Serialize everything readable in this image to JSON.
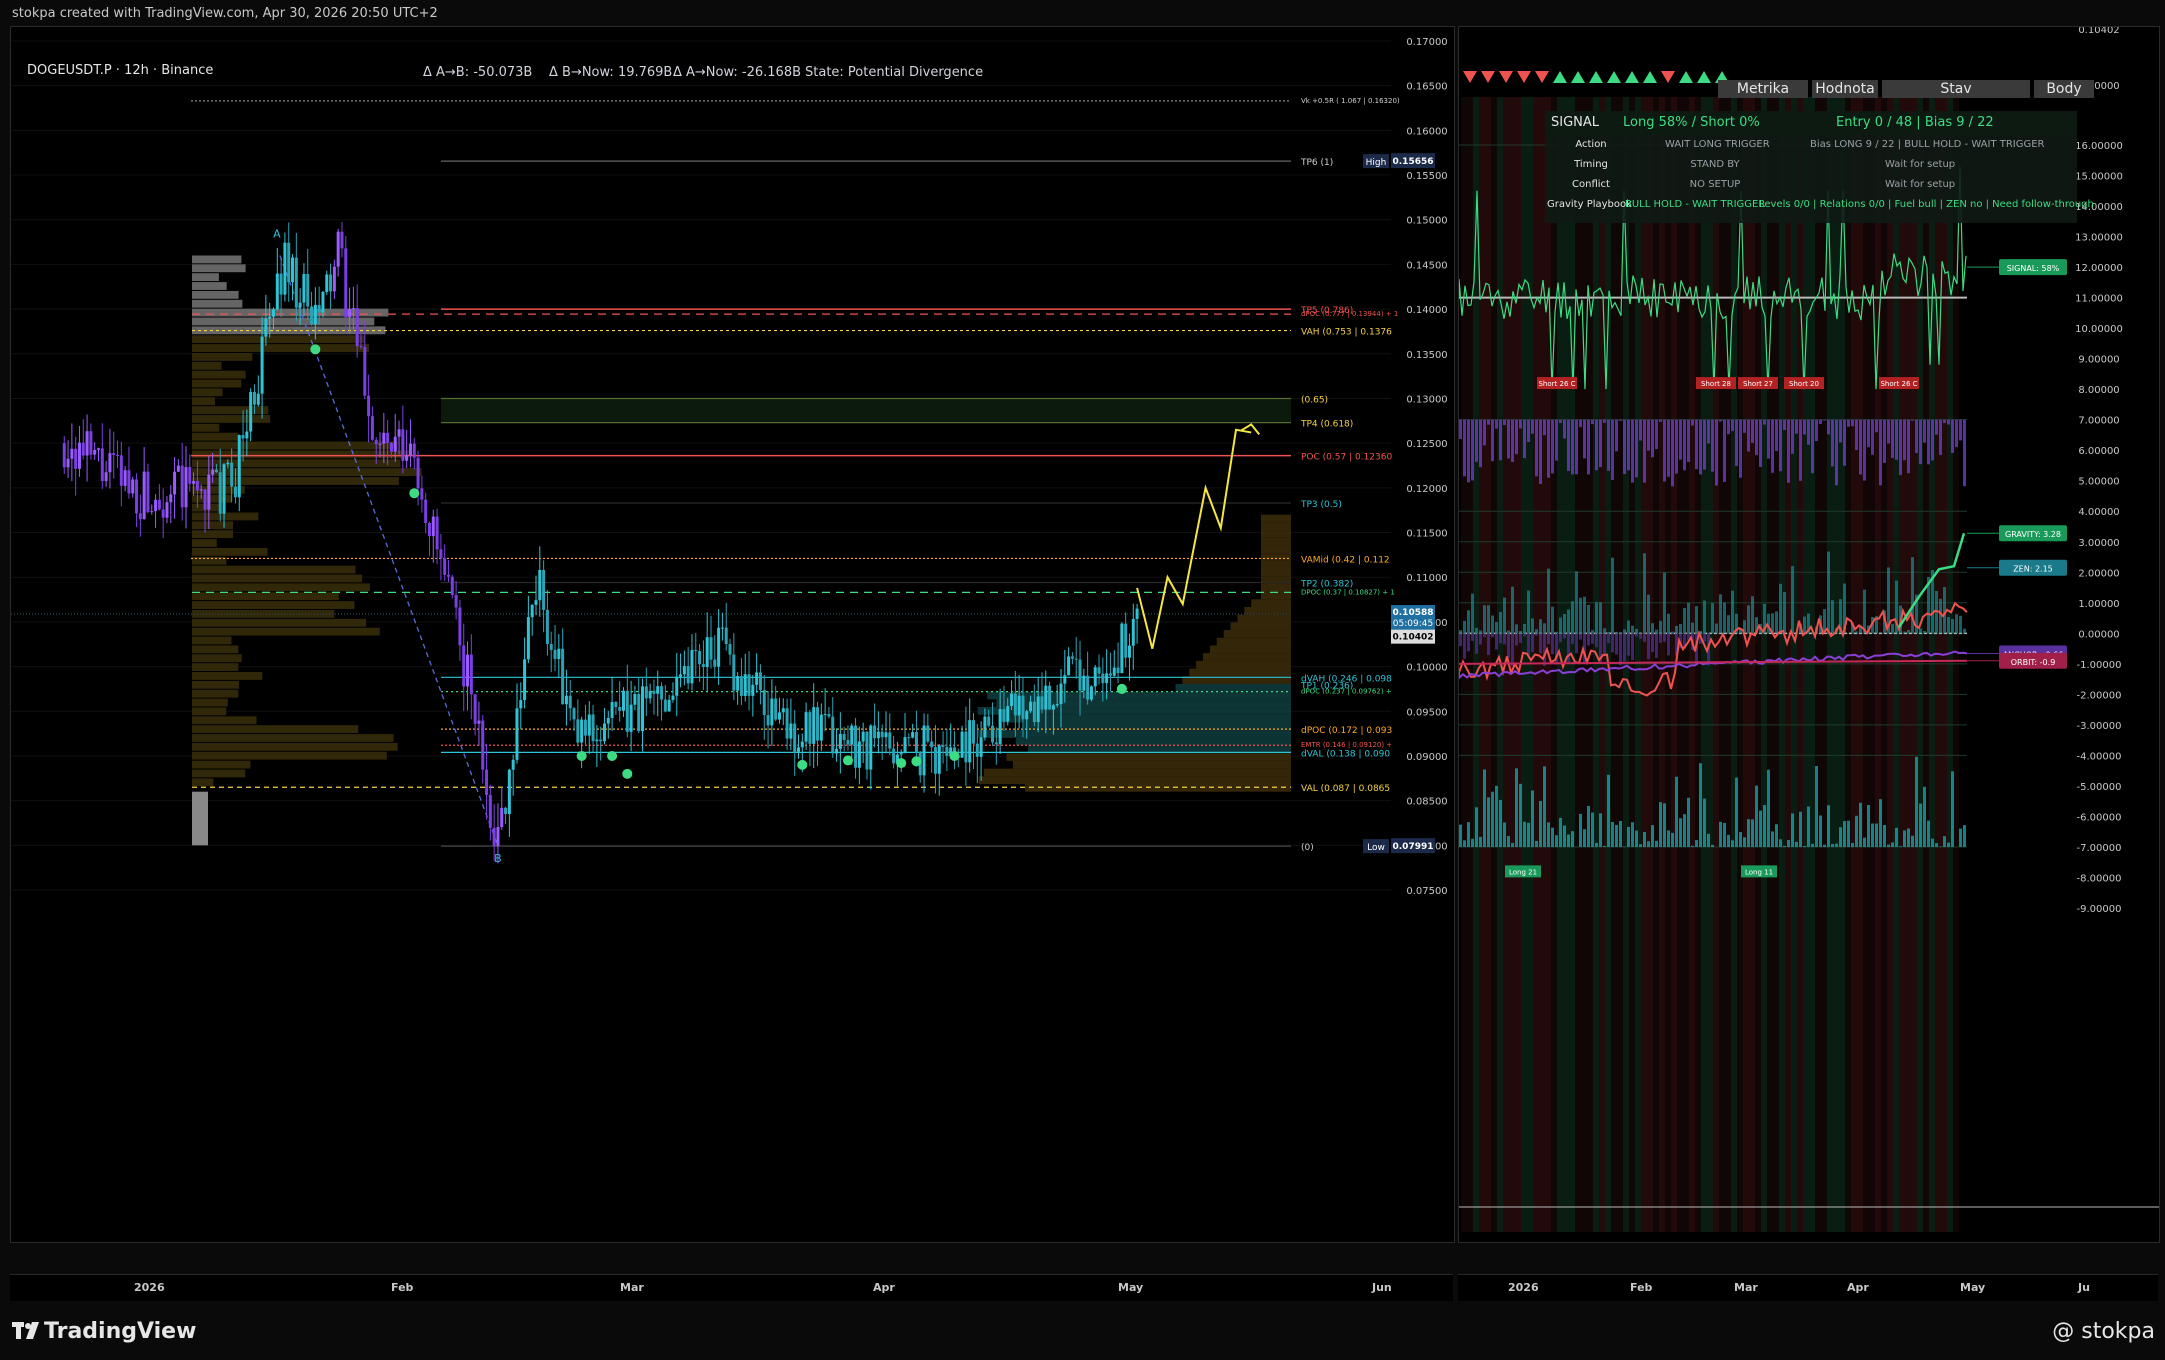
{
  "header": {
    "created_by": "stokpa created with TradingView.com, Apr 30, 2026 20:50 UTC+2"
  },
  "main": {
    "symbol": "DOGEUSDT.P · 12h · Binance",
    "legend": [
      {
        "text": "Δ A→B: -50.073B",
        "color": "#9a5cff"
      },
      {
        "text": "Δ B→Now: 19.769B",
        "color": "#2ec4d6"
      },
      {
        "text": "Δ A→Now: -26.168B",
        "color": "#9a5cff"
      },
      {
        "text": "State: Potential Divergence",
        "color": "#ffa726"
      }
    ],
    "price_axis": [
      "0.17000",
      "0.16500",
      "0.16000",
      "0.15500",
      "0.15000",
      "0.14500",
      "0.14000",
      "0.13500",
      "0.13000",
      "0.12500",
      "0.12000",
      "0.11500",
      "0.11000",
      "0.10500",
      "0.10000",
      "0.09500",
      "0.09000",
      "0.08500",
      "0.08000",
      "0.07500"
    ],
    "badges": {
      "high_label": "High",
      "high_value": "0.15656",
      "price_value": "0.10588",
      "countdown": "05:09:45",
      "low_price": "0.10402",
      "low_label": "Low",
      "low_value": "0.07991"
    },
    "markers": {
      "A": "A",
      "B": "B"
    },
    "levels": [
      {
        "text": "Vk +0.5R ( 1.067 | 0.16320)",
        "color": "#cfcfcf",
        "price": 0.1633,
        "small": true
      },
      {
        "text": "TP6 (1)",
        "color": "#cfcfcf",
        "price": 0.15656
      },
      {
        "text": "TP5 (0.786)",
        "color": "#ef5350",
        "price": 0.14
      },
      {
        "text": "dPOC (0.777 | 0.13944) + 1",
        "color": "#ef5350",
        "price": 0.13944,
        "small": true
      },
      {
        "text": "VAH (0.753 | 0.1376",
        "color": "#f5d142",
        "price": 0.1376
      },
      {
        "text": "(0.65)",
        "color": "#f5d142",
        "price": 0.13
      },
      {
        "text": "TP4 (0.618)",
        "color": "#f5d142",
        "price": 0.1273
      },
      {
        "text": "POC (0.57 | 0.12360",
        "color": "#ef5350",
        "price": 0.1236
      },
      {
        "text": "TP3 (0.5)",
        "color": "#2ec4d6",
        "price": 0.1183
      },
      {
        "text": "VAMid (0.42 | 0.112",
        "color": "#ffa726",
        "price": 0.1121
      },
      {
        "text": "TP2 (0.382)",
        "color": "#2ec4d6",
        "price": 0.1094
      },
      {
        "text": "DPOC (0.37 | 0.10827) + 1",
        "color": "#3ddc84",
        "price": 0.1083,
        "small": true
      },
      {
        "text": "dVAH (0.246 | 0.098",
        "color": "#2ec4d6",
        "price": 0.0988
      },
      {
        "text": "TP1 (0.236)",
        "color": "#2ec4d6",
        "price": 0.098
      },
      {
        "text": "dPOC (0.237 | 0.09762) +",
        "color": "#3ddc84",
        "price": 0.0972,
        "small": true
      },
      {
        "text": "dPOC (0.172 | 0.093",
        "color": "#ffa726",
        "price": 0.093
      },
      {
        "text": "EMTR (0.146 | 0.09120) +",
        "color": "#ef5350",
        "price": 0.0912,
        "small": true
      },
      {
        "text": "dVAL (0.138 | 0.090",
        "color": "#2ec4d6",
        "price": 0.0904
      },
      {
        "text": "VAL (0.087 | 0.0865",
        "color": "#f5d142",
        "price": 0.0865
      },
      {
        "text": "(0)",
        "color": "#cfcfcf",
        "price": 0.07991
      }
    ],
    "time_axis": [
      "2026",
      "Feb",
      "Mar",
      "Apr",
      "May",
      "Jun"
    ]
  },
  "sub": {
    "tabs": [
      "Metrika",
      "Hodnota",
      "Stav",
      "Body"
    ],
    "table": {
      "title": "SIGNAL",
      "long_short": "Long 58% / Short 0%",
      "entry": "Entry 0 / 48 | Bias 9 / 22",
      "rows": [
        {
          "metric": "Action",
          "value": "WAIT LONG TRIGGER",
          "state": "Bias LONG 9 / 22 | BULL HOLD - WAIT TRIGGER"
        },
        {
          "metric": "Timing",
          "value": "STAND BY",
          "state": "Wait for setup"
        },
        {
          "metric": "Conflict",
          "value": "NO SETUP",
          "state": "Wait for setup"
        },
        {
          "metric": "Gravity Playbook",
          "value": "BULL HOLD - WAIT TRIGGER",
          "state": "Levels 0/0 | Relations 0/0 | Fuel bull | ZEN no | Need follow-through"
        }
      ]
    },
    "axis": [
      "0.10402",
      "0.00000",
      "16.00000",
      "15.00000",
      "14.00000",
      "13.00000",
      "12.00000",
      "11.00000",
      "10.00000",
      "9.00000",
      "8.00000",
      "7.00000",
      "6.00000",
      "5.00000",
      "4.00000",
      "3.00000",
      "2.00000",
      "1.00000",
      "0.00000",
      "-1.00000",
      "-2.00000",
      "-3.00000",
      "-4.00000",
      "-5.00000",
      "-6.00000",
      "-7.00000",
      "-8.00000",
      "-9.00000"
    ],
    "tags": {
      "signal": "SIGNAL: 58%",
      "gravity": "GRAVITY: 3.28",
      "zen": "ZEN: 2.15",
      "anchor": "ANCHOR: -0.66",
      "orbit": "ORBIT: -0.9"
    },
    "short_labels": [
      "Short 26 C",
      "Short 28",
      "Short 27",
      "Short 20",
      "Short 26 C"
    ],
    "long_labels": [
      "Long 21",
      "Long 11"
    ],
    "time_axis": [
      "2026",
      "Feb",
      "Mar",
      "Apr",
      "May",
      "Ju"
    ]
  },
  "footer": {
    "logo": "TradingView",
    "author": "@ stokpa"
  },
  "chart_data": {
    "type": "line",
    "title": "DOGEUSDT.P · 12h · Binance",
    "xlabel": "",
    "ylabel": "",
    "x": [
      "2025-12-10",
      "2025-12-20",
      "2026-01-01",
      "2026-01-08",
      "2026-01-12",
      "2026-01-15",
      "2026-01-20",
      "2026-01-25",
      "2026-02-01",
      "2026-02-05",
      "2026-02-10",
      "2026-02-15",
      "2026-02-25",
      "2026-03-05",
      "2026-03-15",
      "2026-03-25",
      "2026-04-05",
      "2026-04-15",
      "2026-04-22",
      "2026-04-27",
      "2026-04-30"
    ],
    "series": [
      {
        "values": [
          0.125,
          0.1195,
          0.12,
          0.146,
          0.138,
          0.146,
          0.125,
          0.123,
          0.099,
          0.08,
          0.11,
          0.092,
          0.096,
          0.103,
          0.093,
          0.0915,
          0.0905,
          0.096,
          0.0985,
          0.1,
          0.1059
        ]
      }
    ],
    "projection": {
      "x": [
        "2026-04-30",
        "2026-05-02",
        "2026-05-04",
        "2026-05-06",
        "2026-05-09",
        "2026-05-11",
        "2026-05-13",
        "2026-05-15"
      ],
      "values": [
        0.1088,
        0.102,
        0.11,
        0.107,
        0.12,
        0.1155,
        0.1265,
        0.1262
      ]
    },
    "ylim": [
      0.075,
      0.173
    ],
    "price_current": 0.10588,
    "high": 0.15656,
    "low": 0.07991,
    "last": 0.10402
  }
}
